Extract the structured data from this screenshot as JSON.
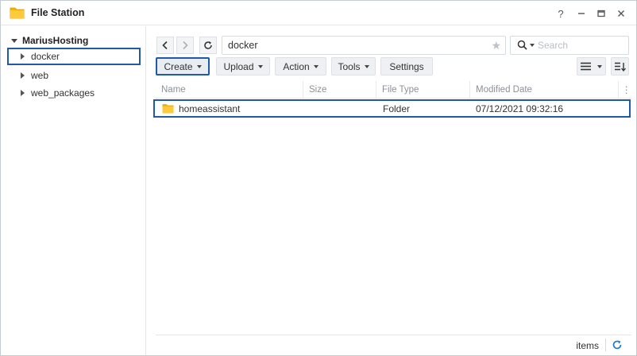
{
  "window": {
    "title": "File Station",
    "controls": [
      "help-icon",
      "minimize-icon",
      "maximize-icon",
      "close-icon"
    ],
    "accent_color": "#1f5aa8",
    "folder_color": "#f4b400"
  },
  "sidebar": {
    "root_label": "MariusHosting",
    "items": [
      {
        "label": "docker",
        "selected": true
      },
      {
        "label": "web",
        "selected": false
      },
      {
        "label": "web_packages",
        "selected": false
      }
    ]
  },
  "navigation": {
    "path": "docker",
    "search_placeholder": "Search"
  },
  "toolbar": {
    "create_label": "Create",
    "upload_label": "Upload",
    "action_label": "Action",
    "tools_label": "Tools",
    "settings_label": "Settings"
  },
  "table": {
    "columns": [
      "Name",
      "Size",
      "File Type",
      "Modified Date"
    ],
    "rows": [
      {
        "name": "homeassistant",
        "size": "",
        "file_type": "Folder",
        "modified": "07/12/2021 09:32:16"
      }
    ]
  },
  "status": {
    "items_label": "items"
  }
}
